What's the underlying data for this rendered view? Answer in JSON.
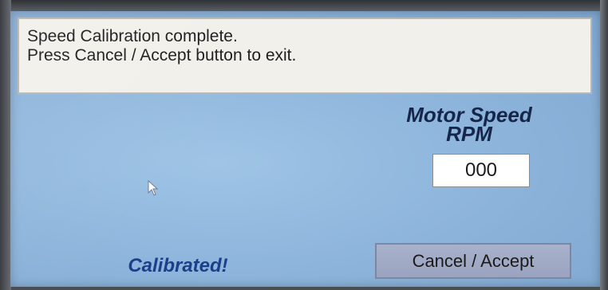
{
  "message": {
    "line1": "Speed Calibration complete.",
    "line2": "Press Cancel / Accept button to exit."
  },
  "motor_speed": {
    "title_line1": "Motor Speed",
    "title_line2": "RPM",
    "value": "000"
  },
  "status": {
    "text": "Calibrated!"
  },
  "buttons": {
    "cancel_accept_label": "Cancel / Accept"
  },
  "icons": {
    "cursor": "mouse-pointer-icon"
  },
  "colors": {
    "screen_background": "#8fb6dc",
    "message_background": "#f1f0ea",
    "title_text": "#16264a",
    "status_text": "#1c3f8a",
    "button_background": "#a9b2cc"
  }
}
